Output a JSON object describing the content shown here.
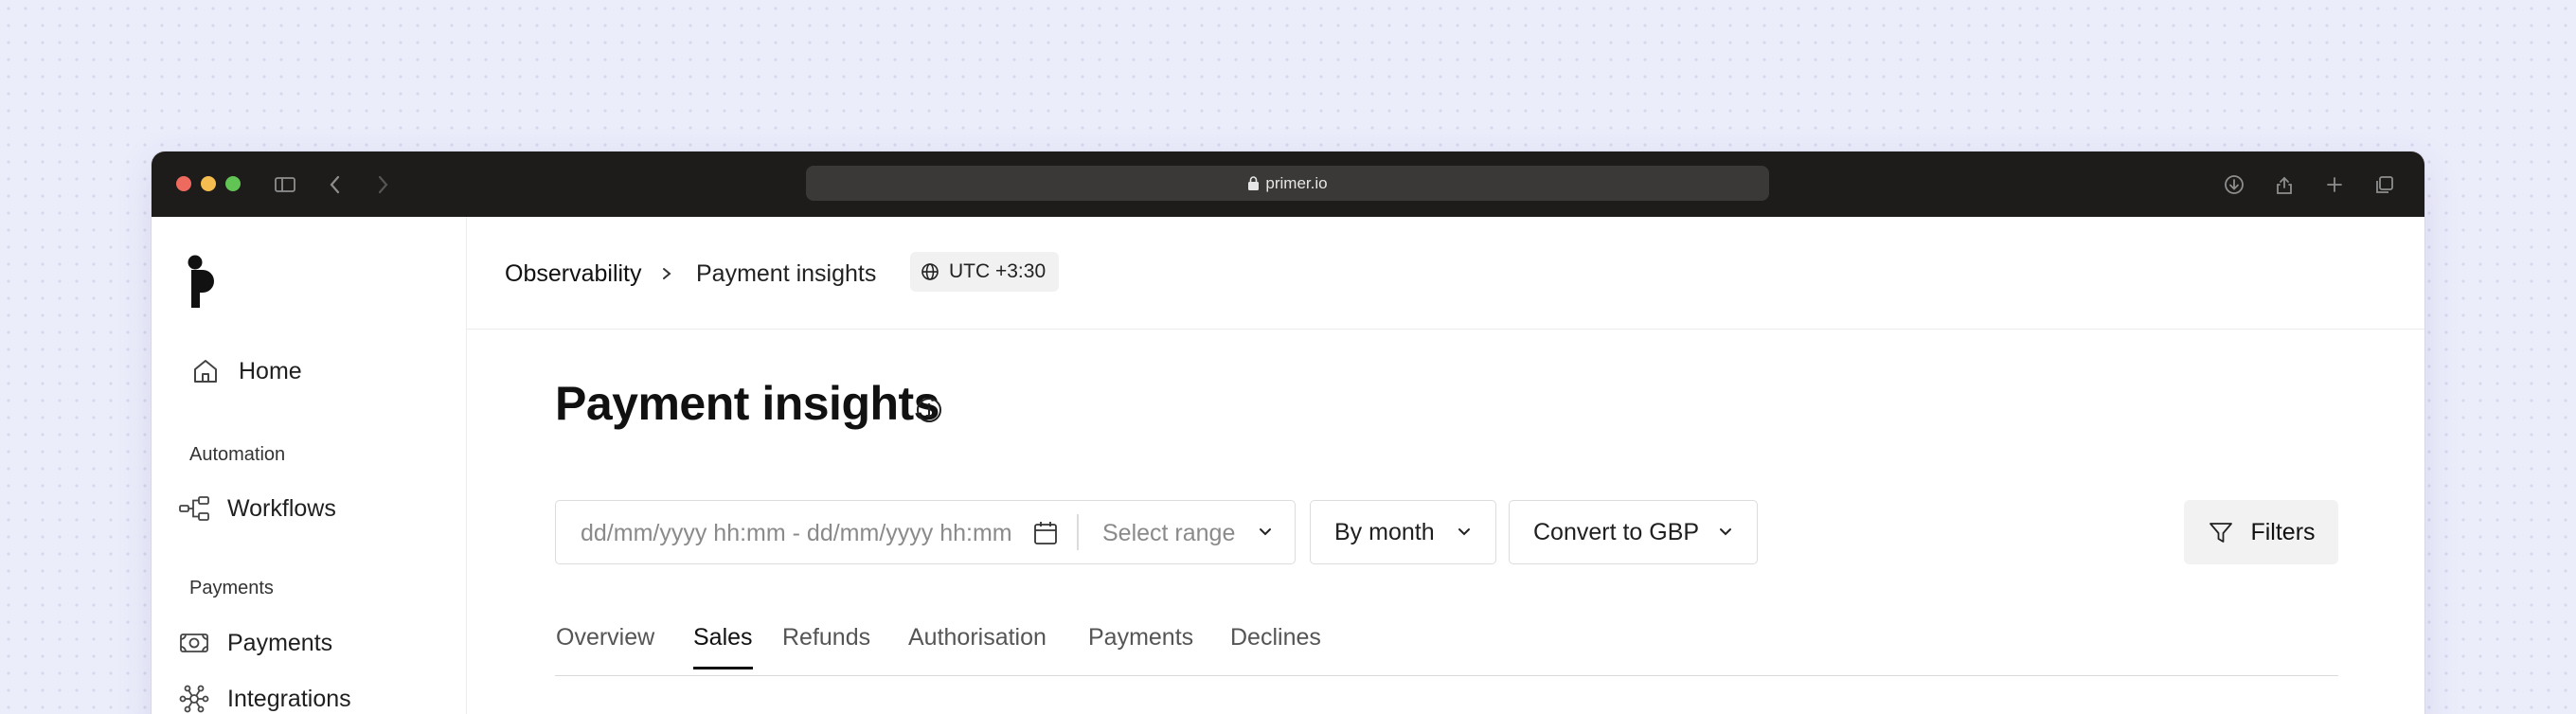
{
  "browser": {
    "url": "primer.io"
  },
  "sidebar": {
    "home_label": "Home",
    "sections": [
      {
        "title": "Automation",
        "items": [
          {
            "label": "Workflows",
            "icon": "workflow-icon"
          }
        ]
      },
      {
        "title": "Payments",
        "items": [
          {
            "label": "Payments",
            "icon": "money-icon"
          },
          {
            "label": "Integrations",
            "icon": "integrations-icon"
          }
        ]
      }
    ]
  },
  "header": {
    "breadcrumb": [
      "Observability",
      "Payment insights"
    ],
    "timezone": "UTC +3:30"
  },
  "main": {
    "title": "Payment insights",
    "controls": {
      "date_placeholder": "dd/mm/yyyy hh:mm - dd/mm/yyyy hh:mm",
      "range_placeholder": "Select range",
      "grouping": "By month",
      "currency": "Convert to GBP",
      "filters_label": "Filters"
    },
    "tabs": [
      {
        "label": "Overview"
      },
      {
        "label": "Sales"
      },
      {
        "label": "Refunds"
      },
      {
        "label": "Authorisation"
      },
      {
        "label": "Payments"
      },
      {
        "label": "Declines"
      }
    ],
    "active_tab": "Sales"
  }
}
